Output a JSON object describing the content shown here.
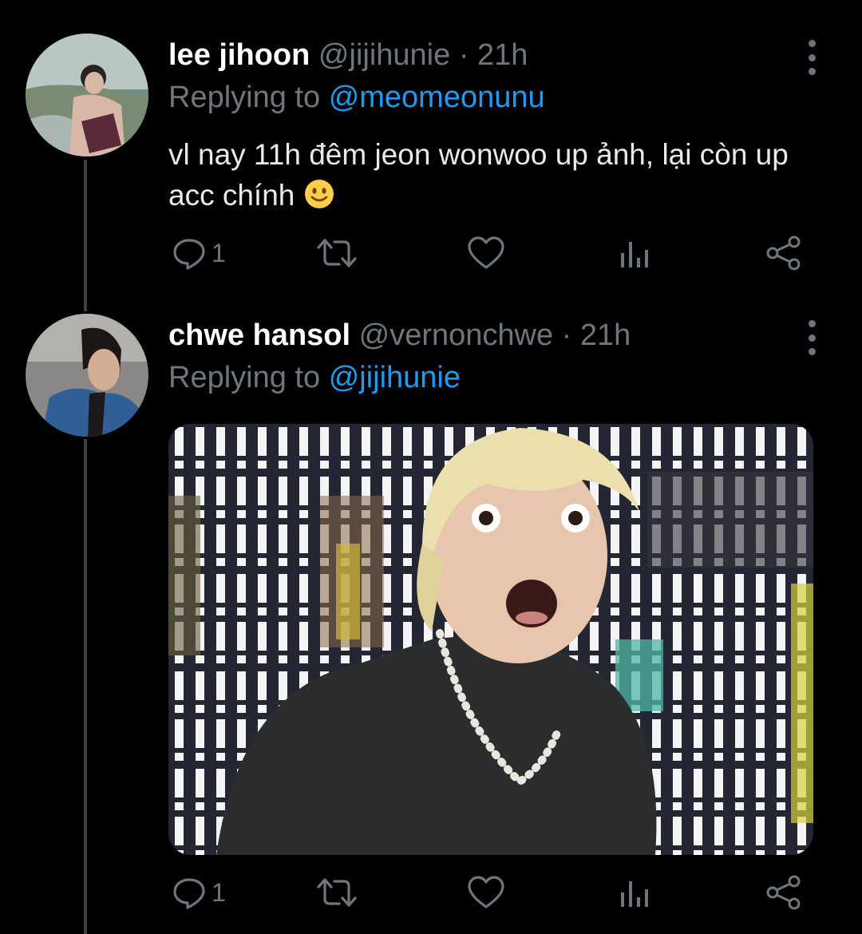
{
  "tweets": [
    {
      "display_name": "lee jihoon",
      "handle": "@jijihunie",
      "separator": "·",
      "time": "21h",
      "replying_prefix": "Replying to",
      "replying_to": "@meomeonunu",
      "text": "vl nay 11h đêm jeon wonwoo up ảnh, lại còn up acc chính",
      "emoji": "slightly-smiling-face",
      "reply_count": "1",
      "avatar_icon": "avatar-photo"
    },
    {
      "display_name": "chwe hansol",
      "handle": "@vernonchwe",
      "separator": "·",
      "time": "21h",
      "replying_prefix": "Replying to",
      "replying_to": "@jijihunie",
      "reply_count": "1",
      "media_icon": "reaction-meme-image",
      "avatar_icon": "avatar-photo"
    }
  ],
  "colors": {
    "background": "#000000",
    "link": "#1d9bf0",
    "muted": "#6e767d",
    "text": "#e7e9ea"
  }
}
